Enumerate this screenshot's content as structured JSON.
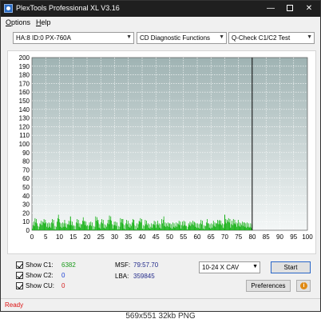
{
  "window": {
    "title": "PlexTools Professional XL V3.16",
    "minimize_glyph": "—",
    "close_glyph": "✕"
  },
  "menu": {
    "options_first": "O",
    "options_rest": "ptions",
    "help_first": "H",
    "help_rest": "elp"
  },
  "toolbar": {
    "drive": "HA:8 ID:0  PX-760A",
    "function": "CD Diagnostic Functions",
    "test": "Q-Check C1/C2 Test"
  },
  "stats": {
    "c1_label": "Show C1:",
    "c1_value": "6382",
    "c2_label": "Show C2:",
    "c2_value": "0",
    "cu_label": "Show CU:",
    "cu_value": "0",
    "msf_label": "MSF:",
    "msf_value": "79:57.70",
    "lba_label": "LBA:",
    "lba_value": "359845"
  },
  "controls": {
    "speed": "10-24 X CAV",
    "start_label": "Start",
    "preferences_label": "Preferences",
    "info_glyph": "i"
  },
  "status": {
    "text": "Ready"
  },
  "caption": "569x551  32kb  PNG",
  "colors": {
    "plot_bg_top": "#9fb3b3",
    "plot_bg_bottom": "#f4f7f7",
    "c1_bars": "#11b011",
    "end_marker": "#000000"
  },
  "chart_data": {
    "type": "bar",
    "x_ticks": [
      0,
      5,
      10,
      15,
      20,
      25,
      30,
      35,
      40,
      45,
      50,
      55,
      60,
      65,
      70,
      75,
      80,
      85,
      90,
      95,
      100
    ],
    "y_ticks": [
      0,
      10,
      20,
      30,
      40,
      50,
      60,
      70,
      80,
      90,
      100,
      110,
      120,
      130,
      140,
      150,
      160,
      170,
      180,
      190,
      200
    ],
    "xlim": [
      0,
      100
    ],
    "ylim": [
      0,
      200
    ],
    "grid": true,
    "end_marker_x": 79.95,
    "series": [
      {
        "name": "C1",
        "x": [
          0.5,
          1.5,
          2.5,
          3.5,
          4.5,
          5.5,
          6.5,
          7.5,
          8.5,
          9.5,
          10.5,
          11.5,
          12.5,
          13.5,
          14.5,
          15.5,
          16.5,
          17.5,
          18.5,
          19.5,
          20.5,
          21.5,
          22.5,
          23.5,
          24.5,
          25.5,
          26.5,
          27.5,
          28.5,
          29.5,
          30.5,
          31.5,
          32.5,
          33.5,
          34.5,
          35.5,
          36.5,
          37.5,
          38.5,
          39.5,
          40.5,
          41.5,
          42.5,
          43.5,
          44.5,
          45.5,
          46.5,
          47.5,
          48.5,
          49.5,
          50.5,
          51.5,
          52.5,
          53.5,
          54.5,
          55.5,
          56.5,
          57.5,
          58.5,
          59.5,
          60.5,
          61.5,
          62.5,
          63.5,
          64.5,
          65.5,
          66.5,
          67.5,
          68.5,
          69.5,
          70.5,
          71.5,
          72.5,
          73.5,
          74.5,
          75.5,
          76.5,
          77.5,
          78.5,
          79.5
        ],
        "values": [
          6,
          11,
          4,
          8,
          12,
          5,
          7,
          9,
          3,
          14,
          6,
          8,
          5,
          10,
          7,
          4,
          9,
          6,
          11,
          8,
          5,
          7,
          4,
          12,
          6,
          9,
          5,
          8,
          14,
          6,
          7,
          4,
          10,
          5,
          8,
          6,
          9,
          3,
          7,
          11,
          5,
          8,
          6,
          4,
          9,
          7,
          5,
          12,
          6,
          8,
          4,
          7,
          5,
          9,
          6,
          8,
          4,
          7,
          10,
          5,
          6,
          8,
          4,
          9,
          5,
          7,
          6,
          11,
          8,
          6,
          9,
          12,
          7,
          10,
          8,
          6,
          9,
          5,
          7,
          4
        ]
      }
    ],
    "peaks": [
      {
        "x": 14,
        "value": 16
      },
      {
        "x": 24,
        "value": 12
      },
      {
        "x": 33,
        "value": 13
      },
      {
        "x": 37,
        "value": 12
      },
      {
        "x": 70,
        "value": 18
      }
    ]
  }
}
